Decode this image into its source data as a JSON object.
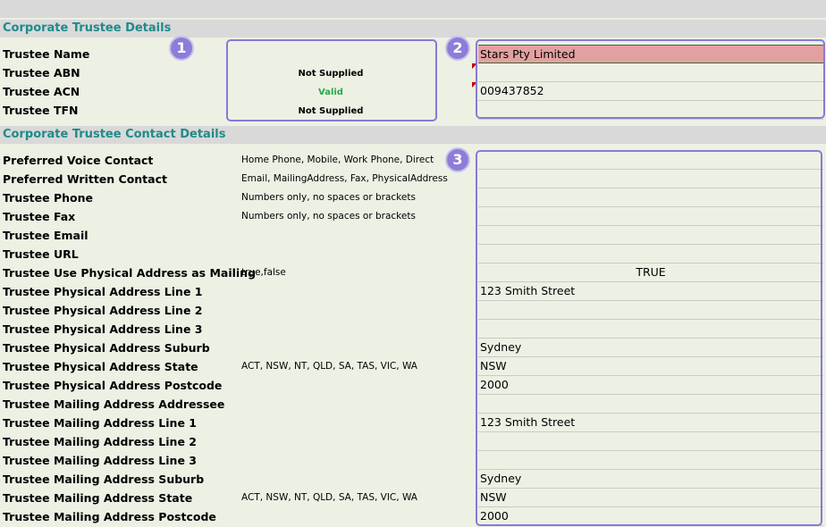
{
  "sections": {
    "details_title": "Corporate Trustee Details",
    "contact_title": "Corporate Trustee Contact Details"
  },
  "badges": [
    "1",
    "2",
    "3"
  ],
  "details": {
    "labels": [
      "Trustee Name",
      "Trustee ABN",
      "Trustee ACN",
      "Trustee TFN"
    ],
    "status": [
      "",
      "Not Supplied",
      "Valid",
      "Not Supplied"
    ],
    "values": [
      "Stars Pty Limited",
      "",
      "009437852",
      ""
    ]
  },
  "contact": {
    "labels": [
      "Preferred Voice Contact",
      "Preferred Written Contact",
      "Trustee Phone",
      "Trustee Fax",
      "Trustee Email",
      "Trustee URL",
      "Trustee Use Physical Address as Mailing",
      "Trustee Physical Address Line 1",
      "Trustee Physical Address Line 2",
      "Trustee Physical Address Line 3",
      "Trustee Physical Address Suburb",
      "Trustee Physical Address State",
      "Trustee Physical Address Postcode",
      "Trustee Mailing Address Addressee",
      "Trustee Mailing Address Line 1",
      "Trustee Mailing Address Line 2",
      "Trustee Mailing Address Line 3",
      "Trustee Mailing Address Suburb",
      "Trustee Mailing Address State",
      "Trustee Mailing Address Postcode"
    ],
    "hints": [
      "Home Phone, Mobile, Work Phone, Direct",
      "Email, MailingAddress, Fax, PhysicalAddress",
      "Numbers only, no spaces or brackets",
      "Numbers only, no spaces or brackets",
      "",
      "",
      "true,false",
      "",
      "",
      "",
      "",
      "ACT, NSW, NT, QLD, SA, TAS, VIC, WA",
      "",
      "",
      "",
      "",
      "",
      "",
      "ACT, NSW, NT, QLD, SA, TAS, VIC, WA",
      ""
    ],
    "values": [
      "",
      "",
      "",
      "",
      "",
      "",
      "TRUE",
      "123 Smith Street",
      "",
      "",
      "Sydney",
      "NSW",
      "2000",
      "",
      "123 Smith Street",
      "",
      "",
      "Sydney",
      "NSW",
      "2000"
    ]
  },
  "colors": {
    "section_text": "#1f8a8a",
    "highlight_box": "#8a78d8",
    "error_fill": "#e3a0a0",
    "valid_text": "#2aa84a"
  }
}
